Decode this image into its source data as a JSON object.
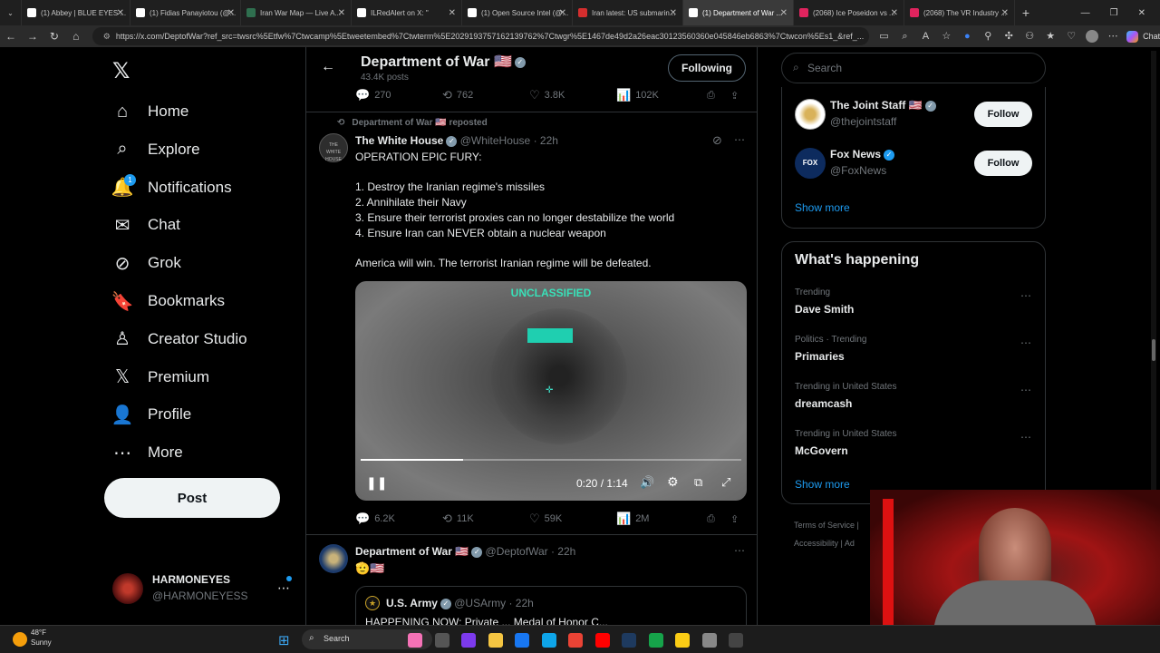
{
  "browser": {
    "tabs": [
      {
        "title": "(1) Abbey | BLUE EYES ...",
        "color": "#ffffff"
      },
      {
        "title": "(1) Fidias Panayiotou (@...",
        "color": "#ffffff"
      },
      {
        "title": "Iran War Map — Live A...",
        "color": "#2f6f4f"
      },
      {
        "title": "ILRedAlert on X: \"",
        "color": "#ffffff"
      },
      {
        "title": "(1) Open Source Intel (@...",
        "color": "#ffffff"
      },
      {
        "title": "Iran latest: US submarin...",
        "color": "#d42e2e"
      },
      {
        "title": "(1) Department of War ...",
        "color": "#ffffff"
      },
      {
        "title": "(2068) Ice Poseidon vs ...",
        "color": "#e0245e"
      },
      {
        "title": "(2068) The VR Industry ...",
        "color": "#e0245e"
      }
    ],
    "active_tab": 6,
    "url": "https://x.com/DeptofWar?ref_src=twsrc%5Etfw%7Ctwcamp%5Etweetembed%7Ctwterm%5E2029193757162139762%7Ctwgr%5E1467de49d2a26eac30123560360e045846eb6863%7Ctwcon%5Es1_&ref_...",
    "chat_label": "Chat"
  },
  "nav": {
    "items": [
      {
        "label": "Home",
        "icon": "home-icon",
        "glyph": "⌂"
      },
      {
        "label": "Explore",
        "icon": "search-icon",
        "glyph": "⌕"
      },
      {
        "label": "Notifications",
        "icon": "bell-icon",
        "glyph": "🔔"
      },
      {
        "label": "Chat",
        "icon": "mail-icon",
        "glyph": "✉"
      },
      {
        "label": "Grok",
        "icon": "grok-icon",
        "glyph": "⊘"
      },
      {
        "label": "Bookmarks",
        "icon": "bookmark-icon",
        "glyph": "🔖"
      },
      {
        "label": "Creator Studio",
        "icon": "creator-icon",
        "glyph": "♙"
      },
      {
        "label": "Premium",
        "icon": "x-premium-icon",
        "glyph": "𝕏"
      },
      {
        "label": "Profile",
        "icon": "profile-icon",
        "glyph": "👤"
      },
      {
        "label": "More",
        "icon": "more-icon",
        "glyph": "⋯"
      }
    ],
    "notification_badge": "1",
    "post_label": "Post",
    "account_name": "HARMONEYES",
    "account_handle": "@HARMONEYESS"
  },
  "profile_header": {
    "name": "Department of War 🇺🇸",
    "posts": "43.4K posts",
    "following_label": "Following"
  },
  "prev_actions": {
    "replies": "270",
    "reposts": "762",
    "likes": "3.8K",
    "views": "102K"
  },
  "tweet": {
    "repost_note": "Department of War 🇺🇸 reposted",
    "author": "The White House",
    "handle": "@WhiteHouse",
    "time": "· 22h",
    "heading": "OPERATION EPIC FURY:",
    "list": [
      "1.  Destroy the Iranian regime's missiles",
      "2.  Annihilate their Navy",
      "3.  Ensure their terrorist proxies can no longer destabilize the world",
      "4.  Ensure Iran can NEVER obtain a nuclear weapon"
    ],
    "closing": "America will win. The terrorist Iranian regime will be defeated.",
    "video": {
      "overlay": "UNCLASSIFIED",
      "time": "0:20 / 1:14",
      "progress": 0.27
    },
    "actions": {
      "replies": "6.2K",
      "reposts": "11K",
      "likes": "59K",
      "views": "2M"
    }
  },
  "tweet2": {
    "author": "Department of War 🇺🇸",
    "handle": "@DeptofWar",
    "time": "· 22h",
    "text": "🫡🇺🇸",
    "quote_author": "U.S. Army",
    "quote_handle": "@USArmy",
    "quote_time": "· 22h",
    "quote_text": "HAPPENING NOW: Private ... Medal of Honor C..."
  },
  "search": {
    "placeholder": "Search"
  },
  "who_to_follow": {
    "accounts": [
      {
        "name": "The Joint Staff 🇺🇸",
        "handle": "@thejointstaff",
        "button": "Follow"
      },
      {
        "name": "Fox News",
        "handle": "@FoxNews",
        "button": "Follow"
      }
    ],
    "show_more": "Show more"
  },
  "happening": {
    "title": "What's happening",
    "trends": [
      {
        "meta": "Trending",
        "name": "Dave Smith"
      },
      {
        "meta": "Politics · Trending",
        "name": "Primaries"
      },
      {
        "meta": "Trending in United States",
        "name": "dreamcash"
      },
      {
        "meta": "Trending in United States",
        "name": "McGovern"
      }
    ],
    "show_more": "Show more"
  },
  "footer": {
    "terms": "Terms of Service",
    "accessibility": "Accessibility",
    "ad": "Ad"
  },
  "taskbar": {
    "temp": "48°F",
    "weather": "Sunny",
    "search": "Search"
  }
}
